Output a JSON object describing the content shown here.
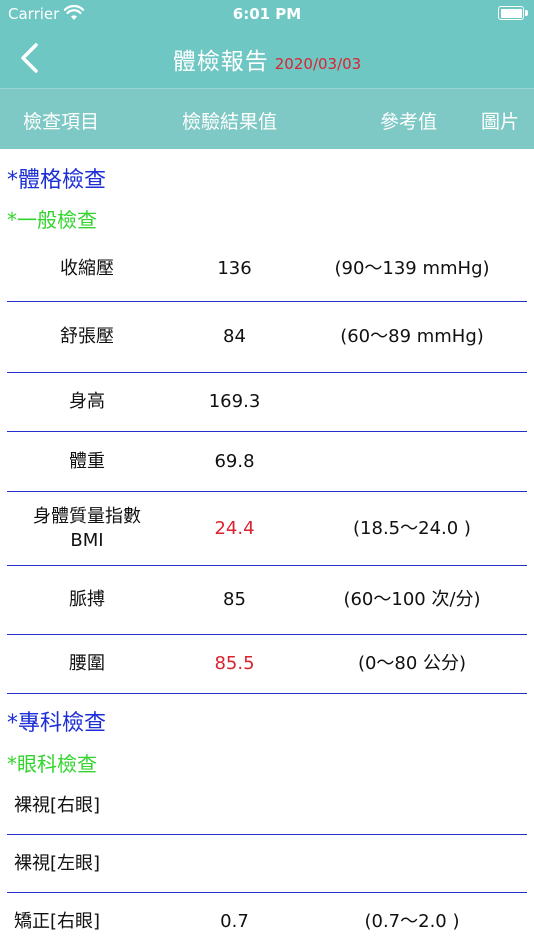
{
  "status_bar": {
    "carrier": "Carrier",
    "time": "6:01 PM"
  },
  "nav": {
    "title": "體檢報告",
    "date": "2020/03/03"
  },
  "columns": {
    "item": "檢查項目",
    "result": "檢驗結果值",
    "reference": "參考值",
    "image": "圖片"
  },
  "sections": [
    {
      "title": "*體格檢查",
      "subtitle": "*一般檢查"
    },
    {
      "title": "*專科檢查",
      "subtitle": "*眼科檢查"
    }
  ],
  "rows": [
    {
      "name": "收縮壓",
      "value": "136",
      "ref": "(90～139 mmHg)",
      "abnormal": false
    },
    {
      "name": "舒張壓",
      "value": "84",
      "ref": "(60～89 mmHg)",
      "abnormal": false
    },
    {
      "name": "身高",
      "value": "169.3",
      "ref": "",
      "abnormal": false
    },
    {
      "name": "體重",
      "value": "69.8",
      "ref": "",
      "abnormal": false
    },
    {
      "name": "身體質量指數BMI",
      "value": "24.4",
      "ref": "(18.5～24.0 )",
      "abnormal": true
    },
    {
      "name": "脈搏",
      "value": "85",
      "ref": "(60～100 次/分)",
      "abnormal": false
    },
    {
      "name": "腰圍",
      "value": "85.5",
      "ref": "(0～80 公分)",
      "abnormal": true
    },
    {
      "name": "裸視[右眼]",
      "value": "",
      "ref": "",
      "abnormal": false
    },
    {
      "name": "裸視[左眼]",
      "value": "",
      "ref": "",
      "abnormal": false
    },
    {
      "name": "矯正[右眼]",
      "value": "0.7",
      "ref": "(0.7～2.0 )",
      "abnormal": false
    }
  ],
  "colors": {
    "header": "#6ec7c3",
    "section": "#1c2fd6",
    "subsection": "#33d42e",
    "abnormal": "#d9232f",
    "divider": "#2330c9"
  }
}
